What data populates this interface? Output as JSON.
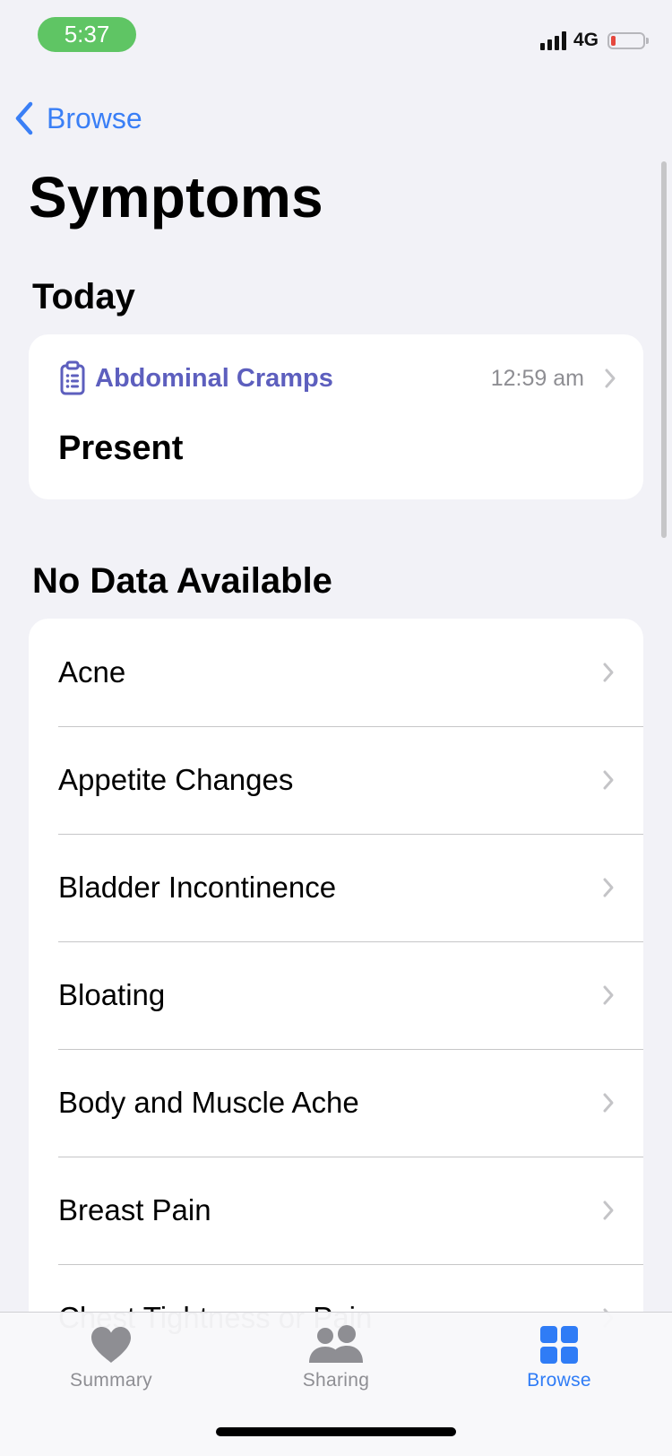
{
  "status_bar": {
    "time": "5:37",
    "network": "4G",
    "battery_level": 0.15
  },
  "nav": {
    "back_label": "Browse",
    "title": "Symptoms"
  },
  "today": {
    "header": "Today",
    "entry": {
      "name": "Abdominal Cramps",
      "time": "12:59 am",
      "value": "Present",
      "icon": "clipboard-list-icon",
      "color": "#5d5fbe"
    }
  },
  "no_data": {
    "header": "No Data Available",
    "items": [
      {
        "label": "Acne"
      },
      {
        "label": "Appetite Changes"
      },
      {
        "label": "Bladder Incontinence"
      },
      {
        "label": "Bloating"
      },
      {
        "label": "Body and Muscle Ache"
      },
      {
        "label": "Breast Pain"
      },
      {
        "label": "Chest Tightness or Pain"
      }
    ]
  },
  "tab_bar": {
    "tabs": [
      {
        "label": "Summary",
        "icon": "heart-icon",
        "active": false
      },
      {
        "label": "Sharing",
        "icon": "people-icon",
        "active": false
      },
      {
        "label": "Browse",
        "icon": "grid-icon",
        "active": true
      }
    ],
    "active_color": "#2f7cf6",
    "inactive_color": "#8e8e93"
  },
  "colors": {
    "accent": "#3a7ff6",
    "status_time_bg": "#5fc564"
  }
}
